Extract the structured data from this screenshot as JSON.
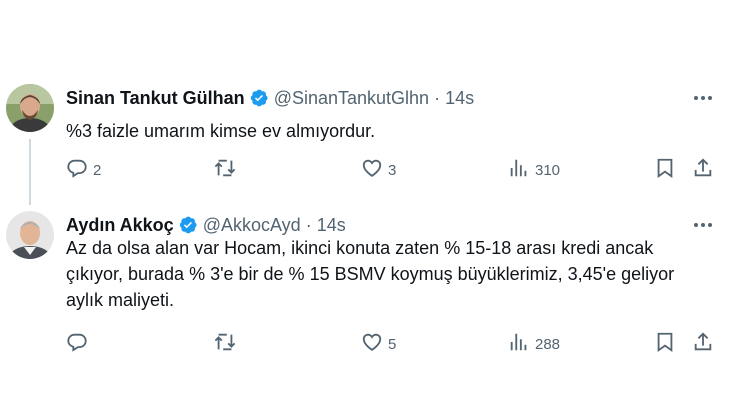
{
  "tweets": [
    {
      "name": "Sinan Tankut Gülhan",
      "handle": "@SinanTankutGlhn",
      "dot": "·",
      "time": "14s",
      "text": "%3 faizle umarım kimse ev almıyordur.",
      "replies": "2",
      "retweets": "",
      "likes": "3",
      "views": "310"
    },
    {
      "name": "Aydın Akkoç",
      "handle": "@AkkocAyd",
      "dot": "·",
      "time": "14s",
      "text": "Az da olsa alan var Hocam, ikinci konuta zaten % 15-18 arası kredi ancak çıkıyor, burada % 3'e bir de % 15 BSMV koymuş büyüklerimiz, 3,45'e geliyor aylık maliyeti.",
      "replies": "",
      "retweets": "",
      "likes": "5",
      "views": "288"
    }
  ],
  "colors": {
    "text": "#0f1419",
    "secondary": "#536471",
    "verified": "#1d9bf0",
    "thread_line": "#cfd9de"
  },
  "icons": [
    "verified-badge-icon",
    "more-icon",
    "reply-icon",
    "retweet-icon",
    "like-icon",
    "views-icon",
    "bookmark-icon",
    "share-icon"
  ]
}
